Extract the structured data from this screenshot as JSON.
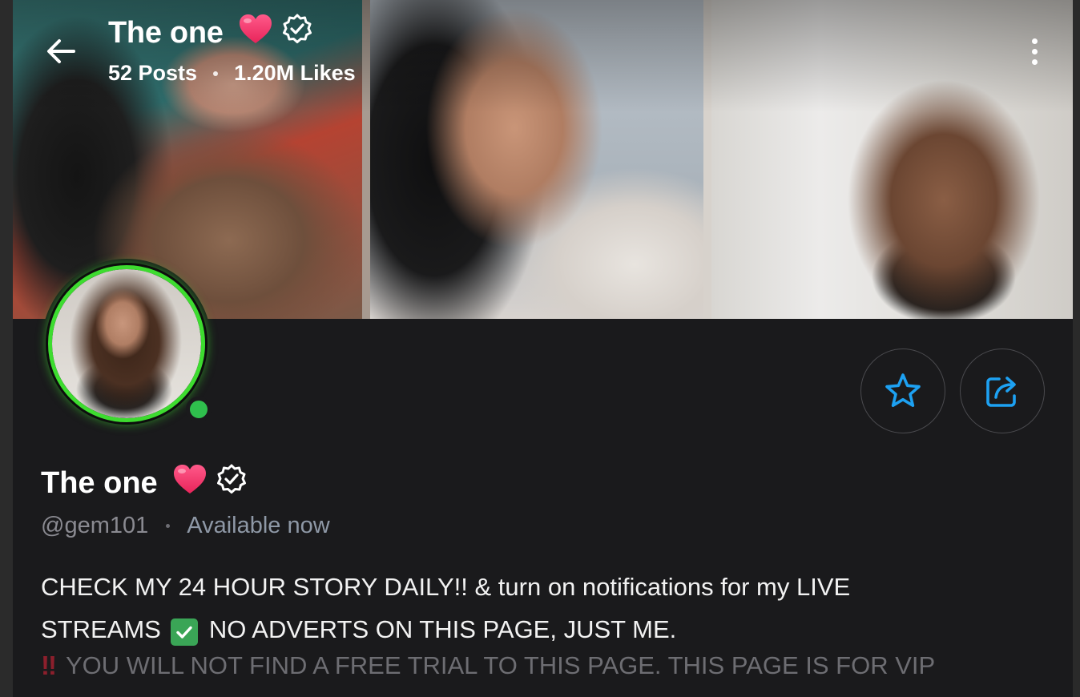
{
  "header": {
    "name": "The one",
    "posts": "52 Posts",
    "likes": "1.20M Likes"
  },
  "profile": {
    "name": "The one",
    "handle": "@gem101",
    "status": "Available now"
  },
  "bio": {
    "line1": "CHECK MY 24 HOUR STORY DAILY!! & turn on notifications for my LIVE",
    "line2a": "STREAMS",
    "line2b": "NO ADVERTS ON THIS PAGE, JUST ME.",
    "line3_mark": "‼",
    "line3": "YOU WILL NOT FIND A FREE TRIAL TO THIS PAGE. THIS PAGE IS FOR VIP"
  },
  "icons": {
    "back": "arrow-left-icon",
    "more": "more-vertical-icon",
    "heart": "heart-icon",
    "verified": "verified-badge-icon",
    "star": "star-icon",
    "share": "share-icon",
    "check": "check-mark-icon"
  },
  "colors": {
    "background": "#1a1a1c",
    "accent_blue": "#1da1f2",
    "online_green": "#2fbf4d",
    "story_ring": "#3ddc2f",
    "heart": "#ff3d78",
    "muted_text": "#8a8a91"
  }
}
